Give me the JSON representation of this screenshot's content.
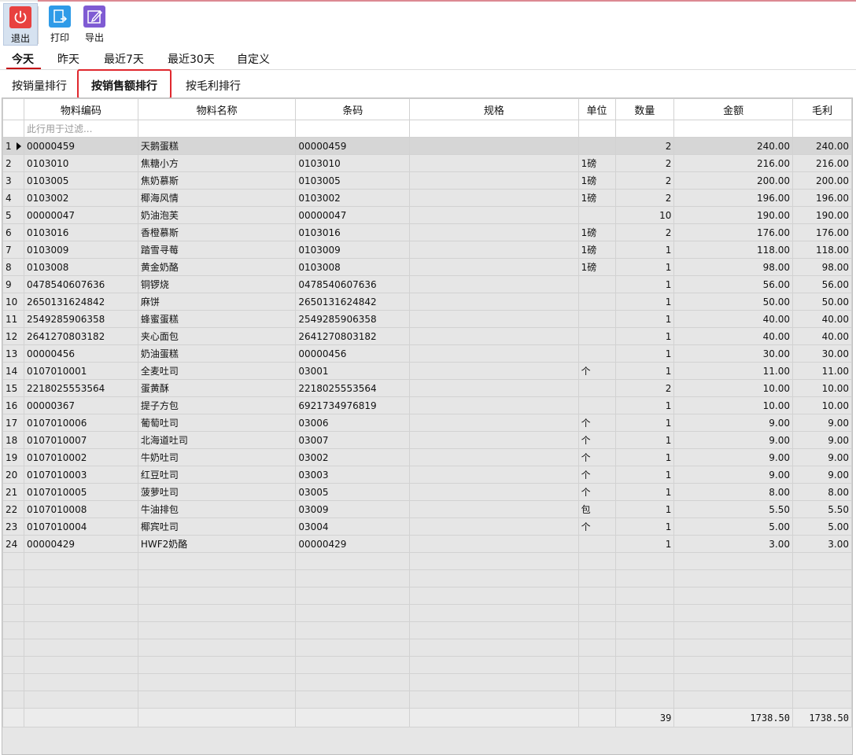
{
  "toolbar": {
    "exit_label": "退出",
    "print_label": "打印",
    "export_label": "导出"
  },
  "date_tabs": [
    "今天",
    "昨天",
    "最近7天",
    "最近30天",
    "自定义"
  ],
  "rank_tabs": [
    "按销量排行",
    "按销售额排行",
    "按毛利排行"
  ],
  "columns": [
    "物料编码",
    "物料名称",
    "条码",
    "规格",
    "单位",
    "数量",
    "金额",
    "毛利"
  ],
  "filter_placeholder": "此行用于过滤...",
  "rows": [
    {
      "n": "1",
      "code": "00000459",
      "name": "天鹅蛋糕",
      "barcode": "00000459",
      "spec": "",
      "unit": "",
      "qty": "2",
      "amount": "240.00",
      "profit": "240.00"
    },
    {
      "n": "2",
      "code": "0103010",
      "name": "焦糖小方",
      "barcode": "0103010",
      "spec": "",
      "unit": "1磅",
      "qty": "2",
      "amount": "216.00",
      "profit": "216.00"
    },
    {
      "n": "3",
      "code": "0103005",
      "name": "焦奶慕斯",
      "barcode": "0103005",
      "spec": "",
      "unit": "1磅",
      "qty": "2",
      "amount": "200.00",
      "profit": "200.00"
    },
    {
      "n": "4",
      "code": "0103002",
      "name": "椰海风情",
      "barcode": "0103002",
      "spec": "",
      "unit": "1磅",
      "qty": "2",
      "amount": "196.00",
      "profit": "196.00"
    },
    {
      "n": "5",
      "code": "00000047",
      "name": "奶油泡芙",
      "barcode": "00000047",
      "spec": "",
      "unit": "",
      "qty": "10",
      "amount": "190.00",
      "profit": "190.00"
    },
    {
      "n": "6",
      "code": "0103016",
      "name": "香橙慕斯",
      "barcode": "0103016",
      "spec": "",
      "unit": "1磅",
      "qty": "2",
      "amount": "176.00",
      "profit": "176.00"
    },
    {
      "n": "7",
      "code": "0103009",
      "name": "踏雪寻莓",
      "barcode": "0103009",
      "spec": "",
      "unit": "1磅",
      "qty": "1",
      "amount": "118.00",
      "profit": "118.00"
    },
    {
      "n": "8",
      "code": "0103008",
      "name": "黄金奶酪",
      "barcode": "0103008",
      "spec": "",
      "unit": "1磅",
      "qty": "1",
      "amount": "98.00",
      "profit": "98.00"
    },
    {
      "n": "9",
      "code": "0478540607636",
      "name": "铜锣烧",
      "barcode": "0478540607636",
      "spec": "",
      "unit": "",
      "qty": "1",
      "amount": "56.00",
      "profit": "56.00"
    },
    {
      "n": "10",
      "code": "2650131624842",
      "name": "麻饼",
      "barcode": "2650131624842",
      "spec": "",
      "unit": "",
      "qty": "1",
      "amount": "50.00",
      "profit": "50.00"
    },
    {
      "n": "11",
      "code": "2549285906358",
      "name": "蜂蜜蛋糕",
      "barcode": "2549285906358",
      "spec": "",
      "unit": "",
      "qty": "1",
      "amount": "40.00",
      "profit": "40.00"
    },
    {
      "n": "12",
      "code": "2641270803182",
      "name": "夹心面包",
      "barcode": "2641270803182",
      "spec": "",
      "unit": "",
      "qty": "1",
      "amount": "40.00",
      "profit": "40.00"
    },
    {
      "n": "13",
      "code": "00000456",
      "name": "奶油蛋糕",
      "barcode": "00000456",
      "spec": "",
      "unit": "",
      "qty": "1",
      "amount": "30.00",
      "profit": "30.00"
    },
    {
      "n": "14",
      "code": "0107010001",
      "name": "全麦吐司",
      "barcode": "03001",
      "spec": "",
      "unit": "个",
      "qty": "1",
      "amount": "11.00",
      "profit": "11.00"
    },
    {
      "n": "15",
      "code": "2218025553564",
      "name": "蛋黄酥",
      "barcode": "2218025553564",
      "spec": "",
      "unit": "",
      "qty": "2",
      "amount": "10.00",
      "profit": "10.00"
    },
    {
      "n": "16",
      "code": "00000367",
      "name": "提子方包",
      "barcode": "6921734976819",
      "spec": "",
      "unit": "",
      "qty": "1",
      "amount": "10.00",
      "profit": "10.00"
    },
    {
      "n": "17",
      "code": "0107010006",
      "name": "葡萄吐司",
      "barcode": "03006",
      "spec": "",
      "unit": "个",
      "qty": "1",
      "amount": "9.00",
      "profit": "9.00"
    },
    {
      "n": "18",
      "code": "0107010007",
      "name": "北海道吐司",
      "barcode": "03007",
      "spec": "",
      "unit": "个",
      "qty": "1",
      "amount": "9.00",
      "profit": "9.00"
    },
    {
      "n": "19",
      "code": "0107010002",
      "name": "牛奶吐司",
      "barcode": "03002",
      "spec": "",
      "unit": "个",
      "qty": "1",
      "amount": "9.00",
      "profit": "9.00"
    },
    {
      "n": "20",
      "code": "0107010003",
      "name": "红豆吐司",
      "barcode": "03003",
      "spec": "",
      "unit": "个",
      "qty": "1",
      "amount": "9.00",
      "profit": "9.00"
    },
    {
      "n": "21",
      "code": "0107010005",
      "name": "菠萝吐司",
      "barcode": "03005",
      "spec": "",
      "unit": "个",
      "qty": "1",
      "amount": "8.00",
      "profit": "8.00"
    },
    {
      "n": "22",
      "code": "0107010008",
      "name": "牛油排包",
      "barcode": "03009",
      "spec": "",
      "unit": "包",
      "qty": "1",
      "amount": "5.50",
      "profit": "5.50"
    },
    {
      "n": "23",
      "code": "0107010004",
      "name": "椰宾吐司",
      "barcode": "03004",
      "spec": "",
      "unit": "个",
      "qty": "1",
      "amount": "5.00",
      "profit": "5.00"
    },
    {
      "n": "24",
      "code": "00000429",
      "name": "HWF2奶酪",
      "barcode": "00000429",
      "spec": "",
      "unit": "",
      "qty": "1",
      "amount": "3.00",
      "profit": "3.00"
    }
  ],
  "totals": {
    "qty": "39",
    "amount": "1738.50",
    "profit": "1738.50"
  },
  "colors": {
    "exit_icon": "#e8413f",
    "print_icon": "#2f9be8",
    "export_icon": "#7f5bd3",
    "active_tab_underline": "#c4000f",
    "highlight_box": "#e0282e"
  }
}
